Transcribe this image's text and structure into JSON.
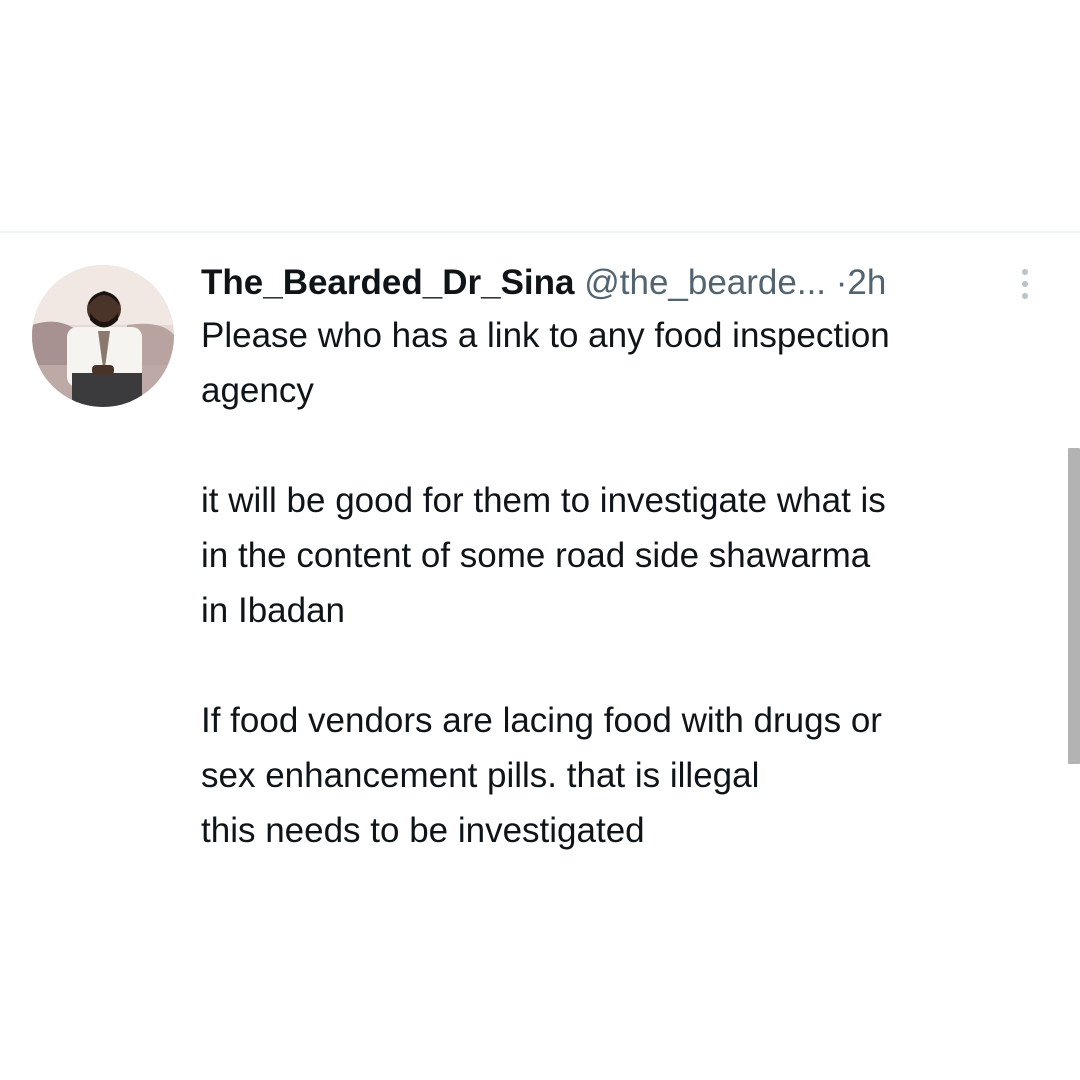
{
  "tweet": {
    "display_name": "The_Bearded_Dr_Sina",
    "handle": "@the_bearde...",
    "separator": "·",
    "time": "2h",
    "body": {
      "line1": "Please who has a link to any food inspection",
      "line2": "agency",
      "line3": "it will be good for them to investigate what is",
      "line4": "in the content of some road side shawarma",
      "line5": "in Ibadan",
      "line6": "If food vendors are lacing food with drugs or",
      "line7": "sex enhancement pills. that is illegal",
      "line8": "this needs to be investigated"
    }
  },
  "icons": {
    "avatar": "profile-photo",
    "more": "vertical-ellipsis-icon"
  },
  "colors": {
    "text_primary": "#0f1419",
    "text_secondary": "#536471",
    "divider": "#eff3f4",
    "scrollbar": "#b3b3b3"
  }
}
